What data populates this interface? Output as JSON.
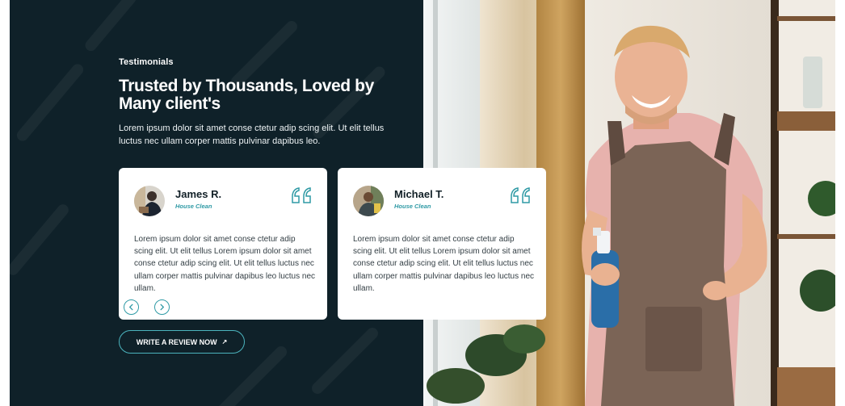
{
  "section": {
    "eyebrow": "Testimonials",
    "headline": "Trusted by Thousands, Loved by Many client's",
    "intro": "Lorem ipsum dolor sit amet conse ctetur adip scing elit. Ut elit tellus luctus nec ullam corper mattis pulvinar dapibus leo."
  },
  "testimonials": [
    {
      "name": "James R.",
      "role": "House Clean",
      "body": "Lorem ipsum dolor sit amet conse ctetur adip scing elit. Ut elit tellus Lorem ipsum dolor sit amet conse ctetur adip scing elit. Ut elit tellus luctus nec ullam corper mattis pulvinar dapibus leo luctus nec ullam."
    },
    {
      "name": "Michael T.",
      "role": "House Clean",
      "body": "Lorem ipsum dolor sit amet conse ctetur adip scing elit. Ut elit tellus Lorem ipsum dolor sit amet conse ctetur adip scing elit. Ut elit tellus luctus nec ullam corper mattis pulvinar dapibus leo luctus nec ullam."
    }
  ],
  "slider": {
    "prev_icon": "chevron-left-icon",
    "next_icon": "chevron-right-icon"
  },
  "cta": {
    "label": "WRITE A REVIEW NOW",
    "icon": "arrow-up-right-icon"
  },
  "icons": {
    "quote": "quote-mark-icon"
  },
  "colors": {
    "panel": "#0f2129",
    "accent": "#2f9aa5",
    "card": "#ffffff",
    "text_dark": "#122027"
  }
}
